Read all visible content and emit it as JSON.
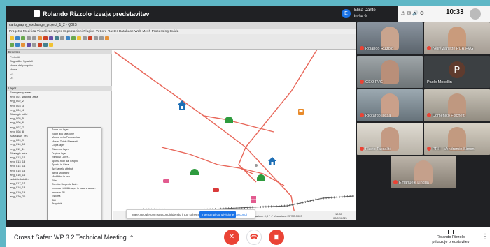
{
  "meet": {
    "presenter_banner": "Rolando Rizzolo izvaja predstavitev",
    "user": {
      "initial": "E",
      "name": "Elisa Dante",
      "sub": "in še 9"
    },
    "tray": {
      "icons": "⚠ ✉ 🔊 ⚙",
      "time": "10:33"
    },
    "meeting_title": "Crossit Safer: WP 3.2 Technical Meeting",
    "presenting_name": "Rolando Rizzolo",
    "presenting_sub": "prikazuje predstavitev",
    "participants": [
      "Rolando Rizzolo",
      "Nelly Zanette PCR FVG",
      "GEO FVG",
      "Paolo Mocellin",
      "Riccardo Iossa",
      "Domenico Fischetti",
      "Flavio Taccaliti",
      "PPH - Vendramin Simon",
      "Emanuele Lingua"
    ],
    "paolo_initial": "P"
  },
  "qgis": {
    "window_title": "cartography_exchange_project_1_2 - QGIS",
    "menu": "Progetto  Modifica  Visualizza  Layer  Impostazioni  Plugins  Vettore  Raster  Database  Web  Mesh  Processing  Guida",
    "browser_header": "Browser",
    "layers_header": "Layer",
    "browser_items": [
      "Preferiti",
      "Segnalibri Spaziali",
      "Home del progetto",
      "Home",
      "C:\\",
      "D:\\"
    ],
    "layers": [
      "Emergency areas",
      "eng_001_waiting_area",
      "eng_002_2",
      "eng_003_3",
      "eng_004_4",
      "Strategic build",
      "eng_005_5",
      "eng_006_6",
      "eng_007_7",
      "eng_008_8",
      "Australian_res",
      "eng_009_9",
      "eng_010_10",
      "eng_011_11",
      "Strategic infra",
      "eng_012_12",
      "eng_013_13",
      "eng_014_14",
      "eng_015_15",
      "eng_016_16",
      "Isolable buildin",
      "eng_017_17",
      "eng_018_18",
      "eng_019_19",
      "eng_020_20"
    ],
    "context_menu": [
      "Zoom sul layer",
      "Zoom alla selezione",
      "Mostra nella Panoramica",
      "Mostra Totale Elementi",
      "Copia layer",
      "Rinomina layer",
      "Duplica layer",
      "Rimuovi Layer...",
      "Sposta fuori dal Gruppo",
      "Sposta in Cima",
      "Apri tabella attributi",
      "Attiva Modifiche",
      "Modifiche in uso",
      "Filtro...",
      "Cambia Sorgente Dati...",
      "Imposta visibilità layer in base a scala...",
      "Imposta SR",
      "Esporta",
      "Stili",
      "Proprietà..."
    ],
    "share_text": "meet.google.com sta condividendo il tuo schermo.",
    "share_stop": "Interrompi condivisione",
    "share_hide": "Nascondi",
    "status": "Scala 1:3,640     Lente d'ingrandimento 100%     Rotazione 0,0 °     ✓ Visualizza     EPSG:3003",
    "status_time": "10:33",
    "status_date": "02/02/2021"
  },
  "colors": {
    "road": "#e8675a",
    "railway": "#555555",
    "blue_poi": "#1f6fb5",
    "green_poi": "#2e9b3e",
    "orange_poi": "#e88a2a",
    "pink_poi": "#e25b8f",
    "red_poi": "#d93a3a",
    "hangup": "#ea4335"
  }
}
